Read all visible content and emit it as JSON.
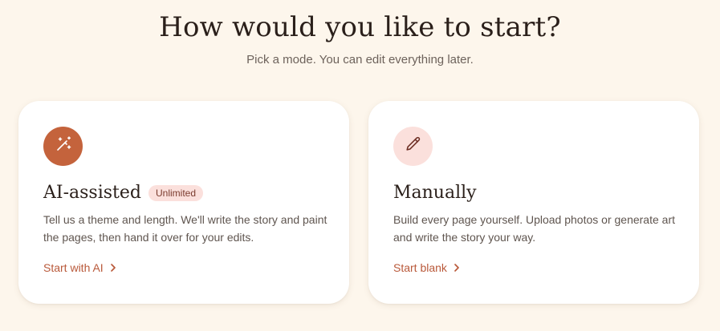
{
  "header": {
    "title": "How would you like to start?",
    "subtitle": "Pick a mode. You can edit everything later."
  },
  "modes": [
    {
      "icon": "magic-wand-icon",
      "title": "AI-assisted",
      "badge": "Unlimited",
      "description": "Tell us a theme and length. We'll write the story and paint the pages, then hand it over for your edits.",
      "link": "Start with AI"
    },
    {
      "icon": "pencil-icon",
      "title": "Manually",
      "description": "Build every page yourself. Upload photos or generate art and write the story your way.",
      "link": "Start blank"
    }
  ],
  "colors": {
    "background": "#fdf6ec",
    "card": "#ffffff",
    "accent": "#c4633c",
    "link": "#b9593a",
    "badge_bg": "#fbe0dc"
  }
}
